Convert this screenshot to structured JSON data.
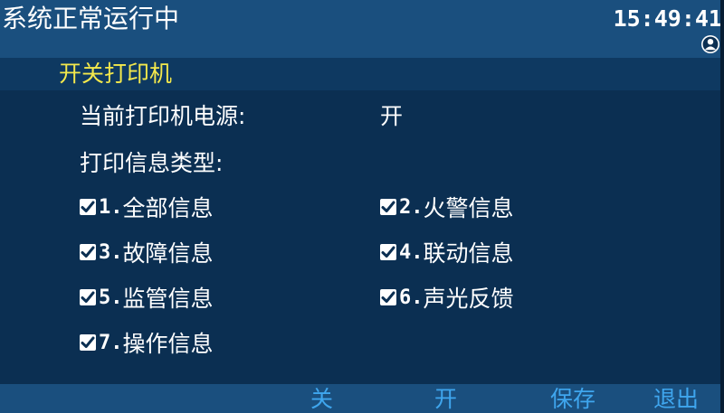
{
  "status": {
    "text": "系统正常运行中",
    "time": "15:49:41",
    "user_icon": "user-icon"
  },
  "title": "开关打印机",
  "power": {
    "label": "当前打印机电源:",
    "value": "开"
  },
  "type_label": "打印信息类型:",
  "options": [
    {
      "num": "1.",
      "text": "全部信息",
      "checked": true
    },
    {
      "num": "2.",
      "text": "火警信息",
      "checked": true
    },
    {
      "num": "3.",
      "text": "故障信息",
      "checked": true
    },
    {
      "num": "4.",
      "text": "联动信息",
      "checked": true
    },
    {
      "num": "5.",
      "text": "监管信息",
      "checked": true
    },
    {
      "num": "6.",
      "text": "声光反馈",
      "checked": true
    },
    {
      "num": "7.",
      "text": "操作信息",
      "checked": true
    }
  ],
  "softkeys": {
    "off": "关",
    "on": "开",
    "save": "保存",
    "exit": "退出"
  },
  "colors": {
    "background": "#0b2f52",
    "bar": "#1a4f7e",
    "title": "#f3e84c",
    "softkey": "#3fa6ee"
  }
}
